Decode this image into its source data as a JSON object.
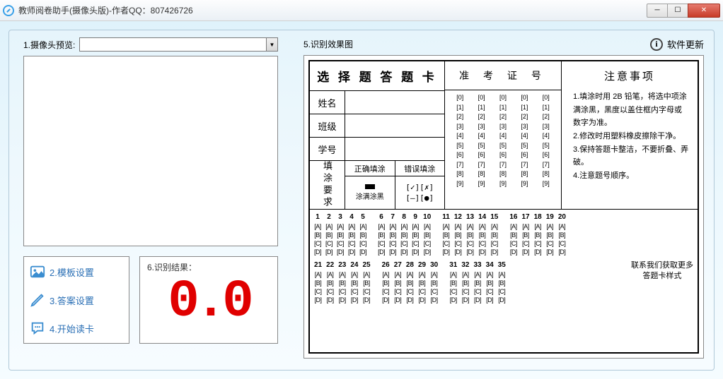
{
  "window": {
    "title": "教师阅卷助手(摄像头版)-作者QQ：807426726"
  },
  "left": {
    "preview_label": "1.摄像头预览:",
    "combo_value": "",
    "btn_template": "2.模板设置",
    "btn_answer": "3.答案设置",
    "btn_start": "4.开始读卡",
    "score_label": "6.识别结果：",
    "score_value": "0.0"
  },
  "right": {
    "result_label": "5.识别效果图",
    "update_label": "软件更新"
  },
  "sheet": {
    "title": "选 择 题 答 题 卡",
    "name": "姓名",
    "class": "班级",
    "sid": "学号",
    "fillreq": "填涂要求",
    "correct": "正确填涂",
    "wrong": "错误填涂",
    "correct_note": "涂满涂黑",
    "exam_id": "准 考 证 号",
    "notice_title": "注意事项",
    "notices": [
      "1.填涂时用 2B 铅笔，将选中项涂满涂黑，黑度以盖住框内字母或数字为准。",
      "2.修改时用塑料橡皮擦除干净。",
      "3.保持答题卡整洁，不要折叠、弄破。",
      "4.注意题号顺序。"
    ],
    "contact1": "联系我们获取更多",
    "contact2": "答题卡样式"
  }
}
